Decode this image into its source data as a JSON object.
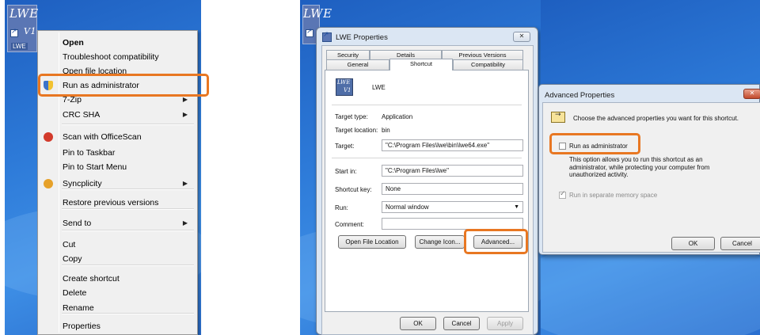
{
  "desktop": {
    "icon_label_top": "LWE",
    "icon_label_partial": "V1",
    "icon_caption": "LWE"
  },
  "context_menu": {
    "items": [
      {
        "label": "Open",
        "bold": true,
        "submenu": false
      },
      {
        "label": "Troubleshoot compatibility",
        "bold": false,
        "submenu": false
      },
      {
        "label": "Open file location",
        "bold": false,
        "submenu": false
      },
      {
        "label": "Run as administrator",
        "bold": false,
        "submenu": false,
        "icon": "uac-shield-icon",
        "highlighted": true
      },
      {
        "label": "7-Zip",
        "bold": false,
        "submenu": true
      },
      {
        "label": "CRC SHA",
        "bold": false,
        "submenu": true
      },
      {
        "label": "Scan with OfficeScan",
        "bold": false,
        "submenu": false,
        "icon": "officescan-icon"
      },
      {
        "label": "Pin to Taskbar",
        "bold": false,
        "submenu": false
      },
      {
        "label": "Pin to Start Menu",
        "bold": false,
        "submenu": false
      },
      {
        "label": "Syncplicity",
        "bold": false,
        "submenu": true,
        "icon": "syncplicity-icon"
      },
      {
        "label": "Restore previous versions",
        "bold": false,
        "submenu": false
      },
      {
        "label": "Send to",
        "bold": false,
        "submenu": true
      },
      {
        "label": "Cut",
        "bold": false,
        "submenu": false
      },
      {
        "label": "Copy",
        "bold": false,
        "submenu": false
      },
      {
        "label": "Create shortcut",
        "bold": false,
        "submenu": false
      },
      {
        "label": "Delete",
        "bold": false,
        "submenu": false
      },
      {
        "label": "Rename",
        "bold": false,
        "submenu": false
      },
      {
        "label": "Properties",
        "bold": false,
        "submenu": false
      }
    ]
  },
  "properties_dialog": {
    "title": "LWE Properties",
    "tabs_row1": [
      "Security",
      "Details",
      "Previous Versions"
    ],
    "tabs_row2": [
      "General",
      "Shortcut",
      "Compatibility"
    ],
    "active_tab": "Shortcut",
    "app_name": "LWE",
    "icon_text_top": "LWE",
    "icon_text_bottom": "V1",
    "target_type_label": "Target type:",
    "target_type_value": "Application",
    "target_location_label": "Target location:",
    "target_location_value": "bin",
    "target_label": "Target:",
    "target_value": "\"C:\\Program Files\\lwe\\bin\\lwe64.exe\"",
    "start_in_label": "Start in:",
    "start_in_value": "\"C:\\Program Files\\lwe\"",
    "shortcut_key_label": "Shortcut key:",
    "shortcut_key_value": "None",
    "run_label": "Run:",
    "run_value": "Normal window",
    "comment_label": "Comment:",
    "comment_value": "",
    "open_file_location_btn": "Open File Location",
    "change_icon_btn": "Change Icon...",
    "advanced_btn": "Advanced...",
    "ok_btn": "OK",
    "cancel_btn": "Cancel",
    "apply_btn": "Apply",
    "close_glyph": "✕"
  },
  "advanced_dialog": {
    "title": "Advanced Properties",
    "description": "Choose the advanced properties you want for this shortcut.",
    "run_as_admin_label": "Run as administrator",
    "run_as_admin_checked": false,
    "info_text": "This option allows you to run this shortcut as an administrator, while protecting your computer from unauthorized activity.",
    "separate_memory_label": "Run in separate memory space",
    "separate_memory_checked": true,
    "ok_btn": "OK",
    "cancel_btn": "Cancel",
    "close_glyph": "✕"
  },
  "colors": {
    "highlight": "#e87722",
    "desktop_blue": "#2d7ad8"
  }
}
